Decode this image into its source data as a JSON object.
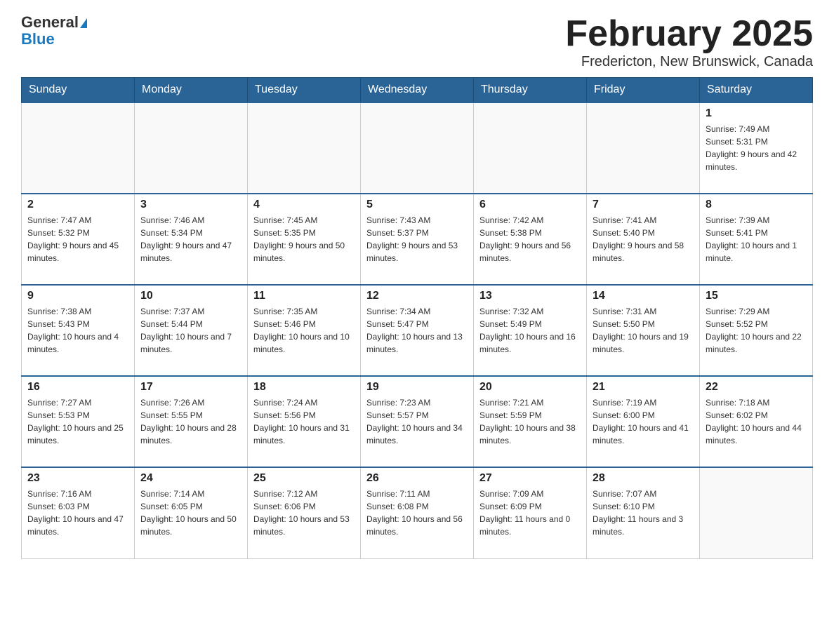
{
  "header": {
    "logo": {
      "general": "General",
      "blue": "Blue"
    },
    "title": "February 2025",
    "location": "Fredericton, New Brunswick, Canada"
  },
  "weekdays": [
    "Sunday",
    "Monday",
    "Tuesday",
    "Wednesday",
    "Thursday",
    "Friday",
    "Saturday"
  ],
  "weeks": [
    [
      {
        "day": "",
        "info": ""
      },
      {
        "day": "",
        "info": ""
      },
      {
        "day": "",
        "info": ""
      },
      {
        "day": "",
        "info": ""
      },
      {
        "day": "",
        "info": ""
      },
      {
        "day": "",
        "info": ""
      },
      {
        "day": "1",
        "info": "Sunrise: 7:49 AM\nSunset: 5:31 PM\nDaylight: 9 hours and 42 minutes."
      }
    ],
    [
      {
        "day": "2",
        "info": "Sunrise: 7:47 AM\nSunset: 5:32 PM\nDaylight: 9 hours and 45 minutes."
      },
      {
        "day": "3",
        "info": "Sunrise: 7:46 AM\nSunset: 5:34 PM\nDaylight: 9 hours and 47 minutes."
      },
      {
        "day": "4",
        "info": "Sunrise: 7:45 AM\nSunset: 5:35 PM\nDaylight: 9 hours and 50 minutes."
      },
      {
        "day": "5",
        "info": "Sunrise: 7:43 AM\nSunset: 5:37 PM\nDaylight: 9 hours and 53 minutes."
      },
      {
        "day": "6",
        "info": "Sunrise: 7:42 AM\nSunset: 5:38 PM\nDaylight: 9 hours and 56 minutes."
      },
      {
        "day": "7",
        "info": "Sunrise: 7:41 AM\nSunset: 5:40 PM\nDaylight: 9 hours and 58 minutes."
      },
      {
        "day": "8",
        "info": "Sunrise: 7:39 AM\nSunset: 5:41 PM\nDaylight: 10 hours and 1 minute."
      }
    ],
    [
      {
        "day": "9",
        "info": "Sunrise: 7:38 AM\nSunset: 5:43 PM\nDaylight: 10 hours and 4 minutes."
      },
      {
        "day": "10",
        "info": "Sunrise: 7:37 AM\nSunset: 5:44 PM\nDaylight: 10 hours and 7 minutes."
      },
      {
        "day": "11",
        "info": "Sunrise: 7:35 AM\nSunset: 5:46 PM\nDaylight: 10 hours and 10 minutes."
      },
      {
        "day": "12",
        "info": "Sunrise: 7:34 AM\nSunset: 5:47 PM\nDaylight: 10 hours and 13 minutes."
      },
      {
        "day": "13",
        "info": "Sunrise: 7:32 AM\nSunset: 5:49 PM\nDaylight: 10 hours and 16 minutes."
      },
      {
        "day": "14",
        "info": "Sunrise: 7:31 AM\nSunset: 5:50 PM\nDaylight: 10 hours and 19 minutes."
      },
      {
        "day": "15",
        "info": "Sunrise: 7:29 AM\nSunset: 5:52 PM\nDaylight: 10 hours and 22 minutes."
      }
    ],
    [
      {
        "day": "16",
        "info": "Sunrise: 7:27 AM\nSunset: 5:53 PM\nDaylight: 10 hours and 25 minutes."
      },
      {
        "day": "17",
        "info": "Sunrise: 7:26 AM\nSunset: 5:55 PM\nDaylight: 10 hours and 28 minutes."
      },
      {
        "day": "18",
        "info": "Sunrise: 7:24 AM\nSunset: 5:56 PM\nDaylight: 10 hours and 31 minutes."
      },
      {
        "day": "19",
        "info": "Sunrise: 7:23 AM\nSunset: 5:57 PM\nDaylight: 10 hours and 34 minutes."
      },
      {
        "day": "20",
        "info": "Sunrise: 7:21 AM\nSunset: 5:59 PM\nDaylight: 10 hours and 38 minutes."
      },
      {
        "day": "21",
        "info": "Sunrise: 7:19 AM\nSunset: 6:00 PM\nDaylight: 10 hours and 41 minutes."
      },
      {
        "day": "22",
        "info": "Sunrise: 7:18 AM\nSunset: 6:02 PM\nDaylight: 10 hours and 44 minutes."
      }
    ],
    [
      {
        "day": "23",
        "info": "Sunrise: 7:16 AM\nSunset: 6:03 PM\nDaylight: 10 hours and 47 minutes."
      },
      {
        "day": "24",
        "info": "Sunrise: 7:14 AM\nSunset: 6:05 PM\nDaylight: 10 hours and 50 minutes."
      },
      {
        "day": "25",
        "info": "Sunrise: 7:12 AM\nSunset: 6:06 PM\nDaylight: 10 hours and 53 minutes."
      },
      {
        "day": "26",
        "info": "Sunrise: 7:11 AM\nSunset: 6:08 PM\nDaylight: 10 hours and 56 minutes."
      },
      {
        "day": "27",
        "info": "Sunrise: 7:09 AM\nSunset: 6:09 PM\nDaylight: 11 hours and 0 minutes."
      },
      {
        "day": "28",
        "info": "Sunrise: 7:07 AM\nSunset: 6:10 PM\nDaylight: 11 hours and 3 minutes."
      },
      {
        "day": "",
        "info": ""
      }
    ]
  ]
}
